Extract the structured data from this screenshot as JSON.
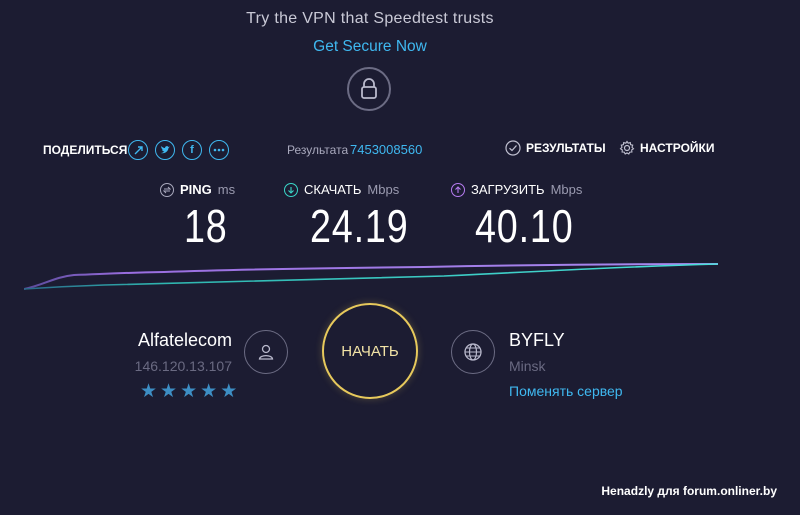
{
  "promo": {
    "text": "Try the VPN that Speedtest trusts",
    "link": "Get Secure Now",
    "lock_icon": "lock-icon"
  },
  "toolbar": {
    "share_label": "ПОДЕЛИТЬСЯ",
    "share_icons": [
      "link-icon",
      "twitter-icon",
      "facebook-icon",
      "more-icon"
    ],
    "result_label": "Результата",
    "result_id": "7453008560",
    "results_label": "РЕЗУЛЬТАТЫ",
    "settings_label": "НАСТРОЙКИ"
  },
  "metrics": {
    "ping": {
      "name": "PING",
      "unit": "ms",
      "value": "18",
      "icon": "ping-icon"
    },
    "download": {
      "name": "СКАЧАТЬ",
      "unit": "Mbps",
      "value": "24.19",
      "icon": "download-icon"
    },
    "upload": {
      "name": "ЗАГРУЗИТЬ",
      "unit": "Mbps",
      "value": "40.10",
      "icon": "upload-icon"
    }
  },
  "isp": {
    "name": "Alfatelecom",
    "ip": "146.120.13.107",
    "stars": 5
  },
  "go_button": "НАЧАТЬ",
  "server": {
    "name": "BYFLY",
    "city": "Minsk",
    "change_label": "Поменять сервер"
  },
  "watermark": "Henadzly для forum.onliner.by",
  "colors": {
    "background": "#1c1c32",
    "accent": "#3fb8f0",
    "download": "#3ad6c8",
    "upload": "#b67cf0",
    "go_button": "#e7c95c"
  }
}
